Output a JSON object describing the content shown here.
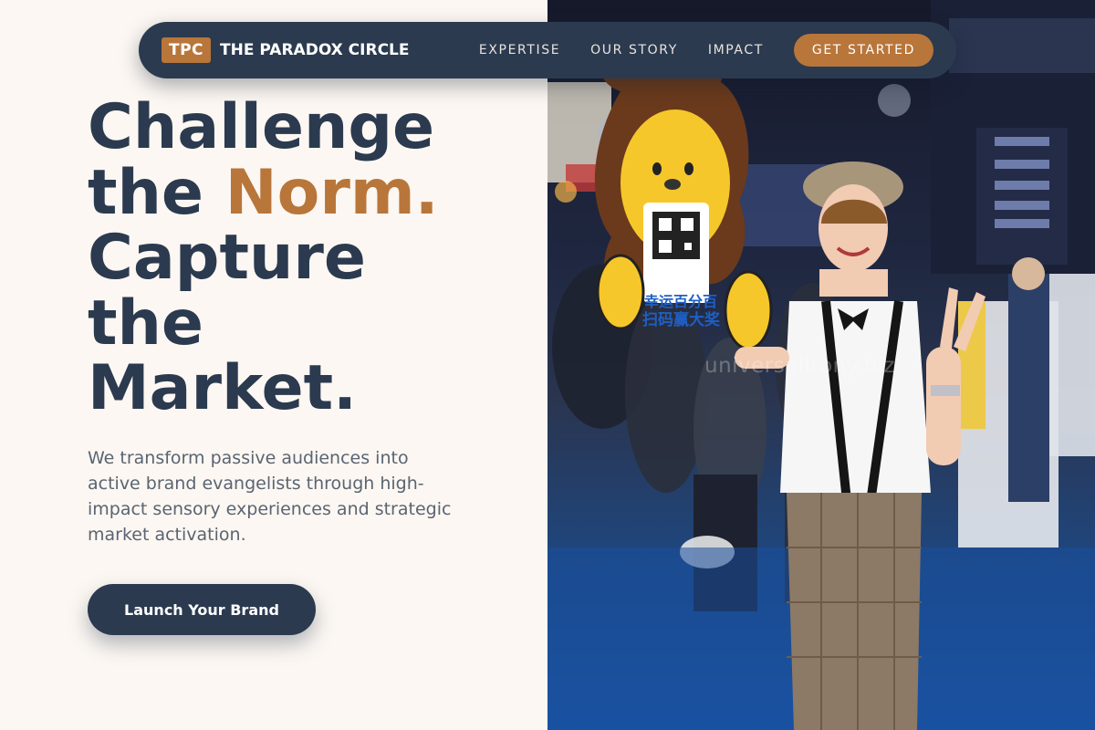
{
  "nav": {
    "logo_abbr": "TPC",
    "brand_name": "THE PARADOX CIRCLE",
    "links": [
      "EXPERTISE",
      "OUR STORY",
      "IMPACT"
    ],
    "cta_label": "GET STARTED"
  },
  "hero": {
    "line1": "Challenge",
    "line2_prefix": "the ",
    "line2_accent": "Norm.",
    "line3": "Capture",
    "line4": "the",
    "line5": "Market.",
    "description": "We transform passive audiences into active brand evangelists through high-impact sensory experiences and strategic market activation.",
    "button_label": "Launch Your Brand"
  },
  "photo": {
    "watermark": "universalirony.biz",
    "sign_text_1": "幸运百分百",
    "sign_text_2": "扫码赢大奖"
  },
  "colors": {
    "navy": "#2b3a4f",
    "accent": "#b8763a",
    "background": "#fcf7f2",
    "body_text": "#5a6472"
  }
}
